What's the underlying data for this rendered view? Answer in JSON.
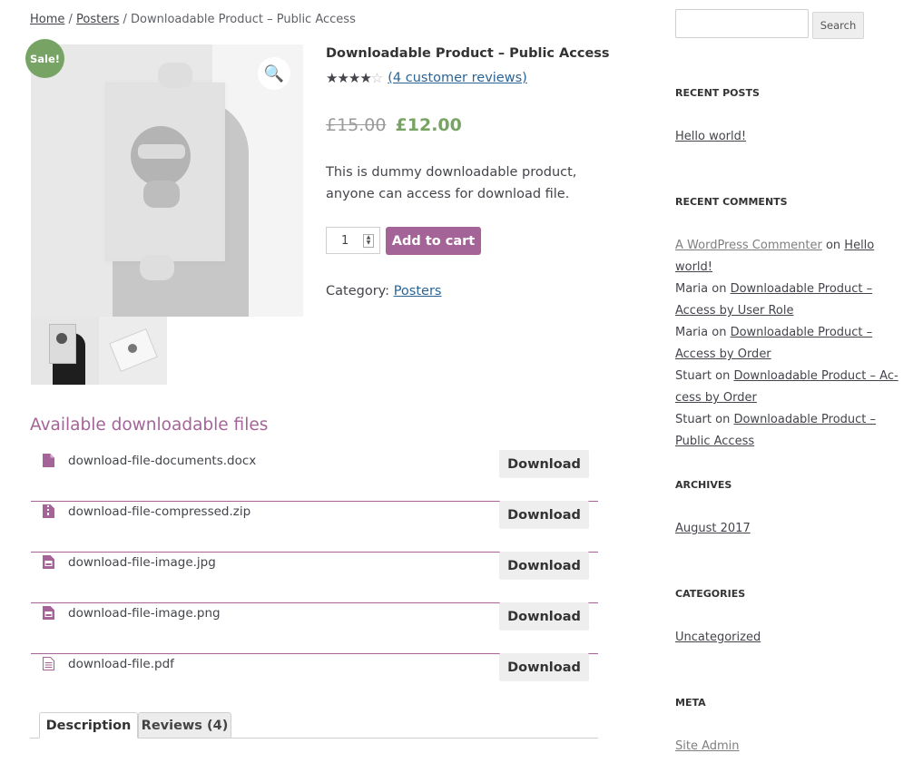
{
  "breadcrumb": {
    "home": "Home",
    "sep1": " / ",
    "posters": "Posters",
    "sep2": " / ",
    "current": "Downloadable Product – Public Access"
  },
  "gallery": {
    "sale_badge": "Sale!",
    "zoom_icon": "magnifier-icon",
    "zoom_glyph": "🔍"
  },
  "product": {
    "title": "Downloadable Product – Public Access",
    "rating_value": 4,
    "rating_max": 5,
    "stars_filled": "★★★★",
    "stars_empty": "☆",
    "review_link": "(4 customer reviews)",
    "price_old": "£15.00",
    "price_new": "£12.00",
    "description": "This is dummy downloadable product, anyone can access for download file.",
    "quantity": "1",
    "add_to_cart": "Add to cart",
    "category_label": "Category: ",
    "category": "Posters"
  },
  "downloads": {
    "heading": "Available downloadable files",
    "button_label": "Download",
    "files": [
      {
        "name": "download-file-documents.docx",
        "icon": "document-icon"
      },
      {
        "name": "download-file-compressed.zip",
        "icon": "archive-icon"
      },
      {
        "name": "download-file-image.jpg",
        "icon": "image-file-icon"
      },
      {
        "name": "download-file-image.png",
        "icon": "image-file-icon"
      },
      {
        "name": "download-file.pdf",
        "icon": "pdf-icon"
      }
    ]
  },
  "tabs": {
    "description": "Description",
    "reviews": "Reviews (4)"
  },
  "sidebar": {
    "search_button": "Search",
    "recent_posts_title": "RECENT POSTS",
    "recent_post": "Hello world!",
    "recent_comments_title": "RECENT COMMENTS",
    "comments": [
      {
        "author": "A WordPress Commenter",
        "on": " on ",
        "post": "Hello world!"
      },
      {
        "author": "Maria",
        "on": " on ",
        "post": "Downloadable Product – Access by User Role"
      },
      {
        "author": "Maria",
        "on": " on ",
        "post": "Downloadable Product – Access by Order"
      },
      {
        "author": "Stuart",
        "on": " on ",
        "post": "Downloadable Product – Ac­cess by Order"
      },
      {
        "author": "Stuart",
        "on": " on ",
        "post": "Downloadable Product – Public Access"
      }
    ],
    "archives_title": "ARCHIVES",
    "archive": "August 2017",
    "categories_title": "CATEGORIES",
    "category": "Uncategorized",
    "meta_title": "META",
    "meta_link": "Site Admin"
  },
  "colors": {
    "accent": "#a46497",
    "sale": "#77a464",
    "link": "#2a6496"
  }
}
